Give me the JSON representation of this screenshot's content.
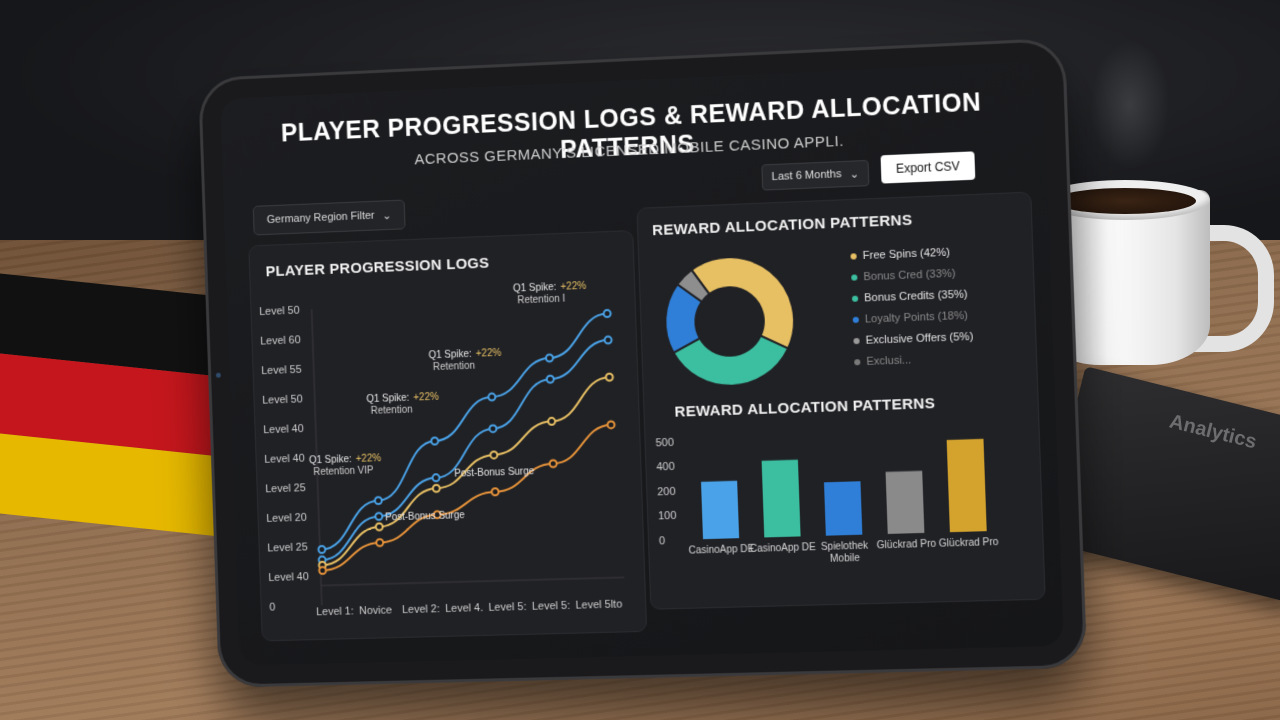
{
  "dashboard": {
    "title": "PLAYER PROGRESSION LOGS & REWARD ALLOCATION PATTERNS",
    "subtitle": "ACROSS GERMANY'S LICENSED MOBILE CASINO APPLI.",
    "period_label": "Last 6 Months",
    "export_label": "Export CSV",
    "region_label": "Germany Region Filter"
  },
  "progression": {
    "title": "PLAYER PROGRESSION LOGS",
    "y_ticks": [
      "Level 50",
      "Level 60",
      "Level 55",
      "Level 50",
      "Level 40",
      "Level 40",
      "Level 25",
      "Level 20",
      "Level 25",
      "Level 40",
      "0"
    ],
    "x_ticks": [
      "Level 1:",
      "Novice",
      "Level 2:",
      "Level 4.",
      "Level 5:",
      "Level 5:",
      "Level 5lto"
    ],
    "annotations": [
      {
        "line1": "Q1 Spike:",
        "line2": "+22%",
        "line3": "Retention I"
      },
      {
        "line1": "Q1 Spike:",
        "line2": "+22%",
        "line3": "Retention"
      },
      {
        "line1": "Q1 Spike:",
        "line2": "+22%",
        "line3": "Retention"
      },
      {
        "line1": "Q1 Spike:",
        "line2": "+22%",
        "line3": "Retention VIP"
      },
      {
        "line1": "Post-Bonus Surge",
        "line2": "",
        "line3": ""
      },
      {
        "line1": "Post-Bonus Surge",
        "line2": "",
        "line3": ""
      }
    ]
  },
  "donut": {
    "title": "REWARD ALLOCATION PATTERNS",
    "legend": [
      {
        "label": "Free Spins (42%)",
        "color": "#e8c064",
        "dim": false
      },
      {
        "label": "Bonus Cred (33%)",
        "color": "#3cbfa0",
        "dim": true
      },
      {
        "label": "Bonus Credits (35%)",
        "color": "#3cbfa0",
        "dim": false
      },
      {
        "label": "Loyalty Points (18%)",
        "color": "#2f7fd8",
        "dim": true
      },
      {
        "label": "Exclusive Offers (5%)",
        "color": "#9a9a9a",
        "dim": false
      },
      {
        "label": "Exclusi...",
        "color": "#7a7a7a",
        "dim": true
      }
    ]
  },
  "bars": {
    "title": "REWARD ALLOCATION PATTERNS",
    "y_ticks": [
      "500",
      "400",
      "200",
      "100",
      "0"
    ],
    "labels": [
      "CasinoApp DE",
      "CasinoApp DE",
      "Spielothek Mobile",
      "Glückrad Pro",
      "Glückrad Pro"
    ]
  },
  "notebook_label": "Analytics",
  "chart_data": [
    {
      "type": "line",
      "title": "PLAYER PROGRESSION LOGS",
      "x": [
        "Level 1:",
        "Novice",
        "Level 2:",
        "Level 4.",
        "Level 5:",
        "Level 5:",
        "Level 5lto"
      ],
      "series": [
        {
          "color": "#4aa3e8",
          "values": [
            5,
            14,
            25,
            33,
            40,
            48
          ]
        },
        {
          "color": "#4aa3e8",
          "values": [
            3,
            11,
            18,
            27,
            36,
            43
          ]
        },
        {
          "color": "#e8c064",
          "values": [
            2,
            9,
            16,
            22,
            28,
            36
          ]
        },
        {
          "color": "#e8943a",
          "values": [
            1,
            6,
            11,
            15,
            20,
            27
          ]
        }
      ]
    },
    {
      "type": "pie",
      "title": "REWARD ALLOCATION PATTERNS",
      "slices": [
        {
          "label": "Free Spins",
          "value": 42,
          "color": "#e8c064"
        },
        {
          "label": "Bonus Credits",
          "value": 35,
          "color": "#3cbfa0"
        },
        {
          "label": "Loyalty Points",
          "value": 18,
          "color": "#2f7fd8"
        },
        {
          "label": "Exclusive Offers",
          "value": 5,
          "color": "#8e8e8e"
        }
      ]
    },
    {
      "type": "bar",
      "title": "REWARD ALLOCATION PATTERNS",
      "categories": [
        "CasinoApp DE",
        "CasinoApp DE",
        "Spielothek Mobile",
        "Glückrad Pro",
        "Glückrad Pro"
      ],
      "values": [
        270,
        360,
        250,
        290,
        430
      ],
      "colors": [
        "#4aa3e8",
        "#3cbfa0",
        "#2f7fd8",
        "#8a8a8a",
        "#d4a32e"
      ],
      "ylim": [
        0,
        500
      ]
    }
  ]
}
